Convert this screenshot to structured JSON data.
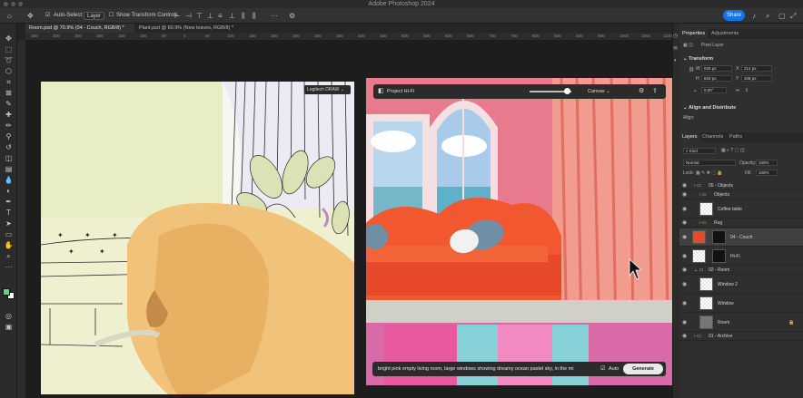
{
  "app_title": "Adobe Photoshop 2024",
  "options_bar": {
    "auto_select_label": "Auto-Select:",
    "auto_select_value": "Layer",
    "show_transform_label": "Show Transform Controls",
    "share_label": "Share"
  },
  "tabs": [
    {
      "label": "Room.psd @ 70.9% (04 - Couch, RGB/8) *"
    },
    {
      "label": "Plant.psd @ 60.9% (New leaves, RGB/8) *"
    }
  ],
  "ruler_ticks": [
    "350",
    "300",
    "250",
    "200",
    "150",
    "100",
    "50",
    "0",
    "50",
    "100",
    "150",
    "200",
    "250",
    "300",
    "350",
    "400",
    "450",
    "500",
    "550",
    "600",
    "650",
    "700",
    "750",
    "800",
    "850",
    "900",
    "950",
    "1000",
    "1050",
    "1100"
  ],
  "doc1": {
    "badge": "Logitech DRAW"
  },
  "hifi": {
    "title": "Project Hi-Fi",
    "source": "Canvas"
  },
  "prompt": {
    "text": "bright pink empty living room, large windows showing dreamy ocean pastel sky, in the mi",
    "auto_label": "Auto",
    "generate_label": "Generate"
  },
  "properties": {
    "tab_properties": "Properties",
    "tab_adjustments": "Adjustments",
    "pixel_layer": "Pixel Layer",
    "transform_title": "Transform",
    "w_label": "W",
    "w_value": "826 px",
    "x_label": "X",
    "x_value": "214 px",
    "h_label": "H",
    "h_value": "826 px",
    "y_label": "Y",
    "y_value": "406 px",
    "angle_value": "0.00°",
    "align_title": "Align and Distribute",
    "align_label": "Align:"
  },
  "layers_panel": {
    "tab_layers": "Layers",
    "tab_channels": "Channels",
    "tab_paths": "Paths",
    "kind_label": "Kind",
    "blend_mode": "Normal",
    "opacity_label": "Opacity:",
    "opacity_value": "100%",
    "lock_label": "Lock:",
    "fill_label": "Fill:",
    "fill_value": "100%",
    "rows": [
      {
        "name": "05 - Objects",
        "type": "group"
      },
      {
        "name": "Objects",
        "type": "group"
      },
      {
        "name": "Coffee table",
        "type": "layer"
      },
      {
        "name": "Rug",
        "type": "group"
      },
      {
        "name": "04 - Couch",
        "type": "layer"
      },
      {
        "name": "Hi-Fi",
        "type": "layer"
      },
      {
        "name": "02 - Room",
        "type": "group"
      },
      {
        "name": "Window 2",
        "type": "layer"
      },
      {
        "name": "Window",
        "type": "layer"
      },
      {
        "name": "Room",
        "type": "layer"
      },
      {
        "name": "01 - Archive",
        "type": "group"
      }
    ]
  },
  "colors": {
    "accent": "#1473e6",
    "foreground_swatch": "#6bd17c",
    "background_swatch": "#ffffff"
  }
}
